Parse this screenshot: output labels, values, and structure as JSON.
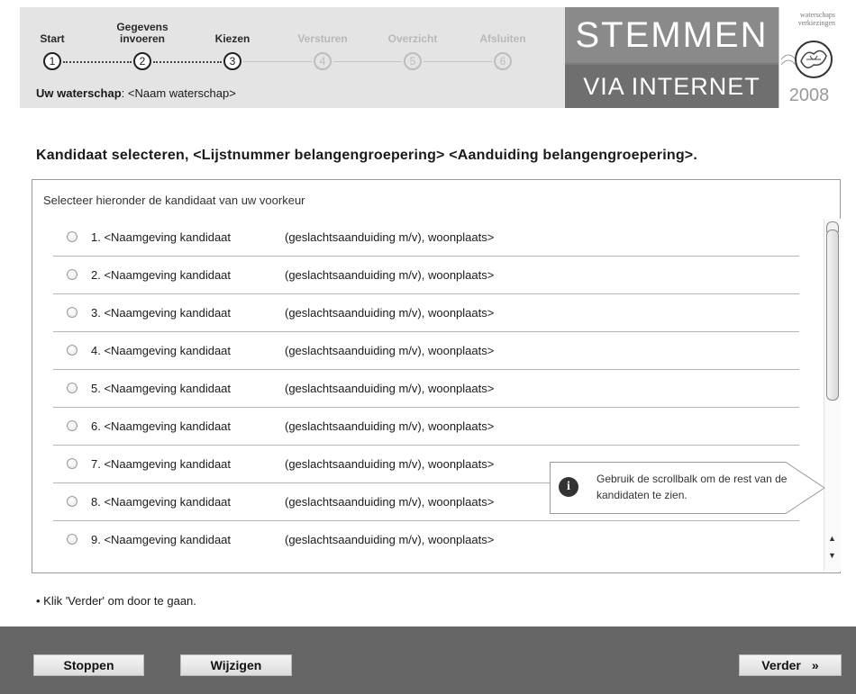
{
  "steps": [
    {
      "label": "Start",
      "number": "1",
      "state": "done"
    },
    {
      "label": "Gegevens\ninvoeren",
      "number": "2",
      "state": "done"
    },
    {
      "label": "Kiezen",
      "number": "3",
      "state": "done"
    },
    {
      "label": "Versturen",
      "number": "4",
      "state": "todo"
    },
    {
      "label": "Overzicht",
      "number": "5",
      "state": "todo"
    },
    {
      "label": "Afsluiten",
      "number": "6",
      "state": "todo"
    }
  ],
  "header": {
    "waterschap_label": "Uw waterschap",
    "waterschap_value": ": <Naam waterschap>",
    "banner_top": "STEMMEN",
    "banner_bottom": "VIA INTERNET",
    "logo_text": "waterschaps\nverkiezingen",
    "logo_year": "2008"
  },
  "main": {
    "title": "Kandidaat selecteren, <Lijstnummer belangengroepering> <Aanduiding belangengroepering>.",
    "panel_header": "Selecteer hieronder de kandidaat van uw voorkeur",
    "candidates": [
      {
        "name": "1. <Naamgeving kandidaat",
        "extra": "(geslachtsaanduiding m/v), woonplaats>"
      },
      {
        "name": "2. <Naamgeving kandidaat",
        "extra": "(geslachtsaanduiding m/v), woonplaats>"
      },
      {
        "name": "3. <Naamgeving kandidaat",
        "extra": "(geslachtsaanduiding m/v), woonplaats>"
      },
      {
        "name": "4. <Naamgeving kandidaat",
        "extra": "(geslachtsaanduiding m/v), woonplaats>"
      },
      {
        "name": "5. <Naamgeving kandidaat",
        "extra": "(geslachtsaanduiding m/v), woonplaats>"
      },
      {
        "name": "6. <Naamgeving kandidaat",
        "extra": "(geslachtsaanduiding m/v), woonplaats>"
      },
      {
        "name": "7. <Naamgeving kandidaat",
        "extra": "(geslachtsaanduiding m/v), woonplaats>"
      },
      {
        "name": "8. <Naamgeving kandidaat",
        "extra": "(geslachtsaanduiding m/v), woonplaats>"
      },
      {
        "name": "9. <Naamgeving kandidaat",
        "extra": "(geslachtsaanduiding m/v), woonplaats>"
      }
    ],
    "tooltip": "Gebruik de scrollbalk om de rest van de kandidaten te zien.",
    "note": "• Klik 'Verder' om door te gaan."
  },
  "footer": {
    "stop_label": "Stoppen",
    "edit_label": "Wijzigen",
    "next_label": "Verder",
    "next_icon": "»"
  }
}
